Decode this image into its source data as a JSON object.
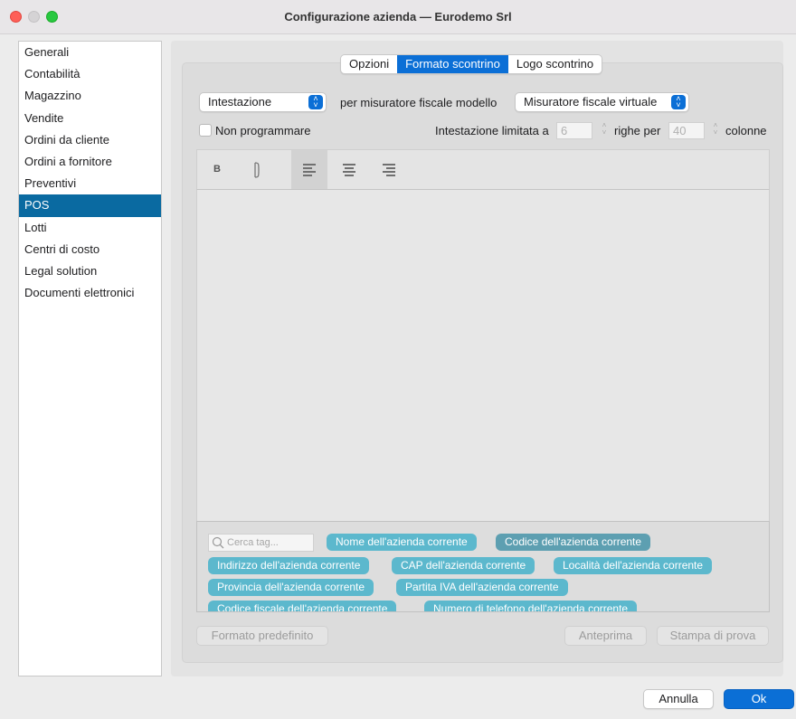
{
  "window": {
    "title": "Configurazione azienda — Eurodemo Srl"
  },
  "sidebar": {
    "items": [
      {
        "label": "Generali"
      },
      {
        "label": "Contabilità"
      },
      {
        "label": "Magazzino"
      },
      {
        "label": "Vendite"
      },
      {
        "label": "Ordini da cliente"
      },
      {
        "label": "Ordini a fornitore"
      },
      {
        "label": "Preventivi"
      },
      {
        "label": "POS",
        "selected": true
      },
      {
        "label": "Lotti"
      },
      {
        "label": "Centri di costo"
      },
      {
        "label": "Legal solution"
      },
      {
        "label": "Documenti elettronici"
      }
    ]
  },
  "tabs": [
    {
      "label": "Opzioni"
    },
    {
      "label": "Formato scontrino",
      "active": true
    },
    {
      "label": "Logo scontrino"
    }
  ],
  "header_row": {
    "section_select": "Intestazione",
    "model_label": "per misuratore fiscale modello",
    "model_select": "Misuratore fiscale virtuale"
  },
  "options_row": {
    "no_program_label": "Non programmare",
    "no_program_checked": false,
    "limit_label": "Intestazione limitata a",
    "rows_value": "6",
    "rows_label": "righe per",
    "cols_value": "40",
    "cols_label": "colonne"
  },
  "toolbar": {
    "bold_label": "B",
    "italic_label": "I"
  },
  "tags": {
    "search_placeholder": "Cerca tag...",
    "items": [
      {
        "label": "Nome dell'azienda corrente"
      },
      {
        "label": "Codice dell'azienda corrente"
      },
      {
        "label": "Indirizzo dell'azienda corrente"
      },
      {
        "label": "CAP dell'azienda corrente"
      },
      {
        "label": "Località dell'azienda corrente"
      },
      {
        "label": "Provincia dell'azienda corrente"
      },
      {
        "label": "Partita IVA dell'azienda corrente"
      },
      {
        "label": "Codice fiscale dell'azienda corrente"
      },
      {
        "label": "Numero di telefono dell'azienda corrente"
      }
    ]
  },
  "buttons": {
    "default_format": "Formato predefinito",
    "preview": "Anteprima",
    "test_print": "Stampa di prova",
    "cancel": "Annulla",
    "ok": "Ok"
  }
}
